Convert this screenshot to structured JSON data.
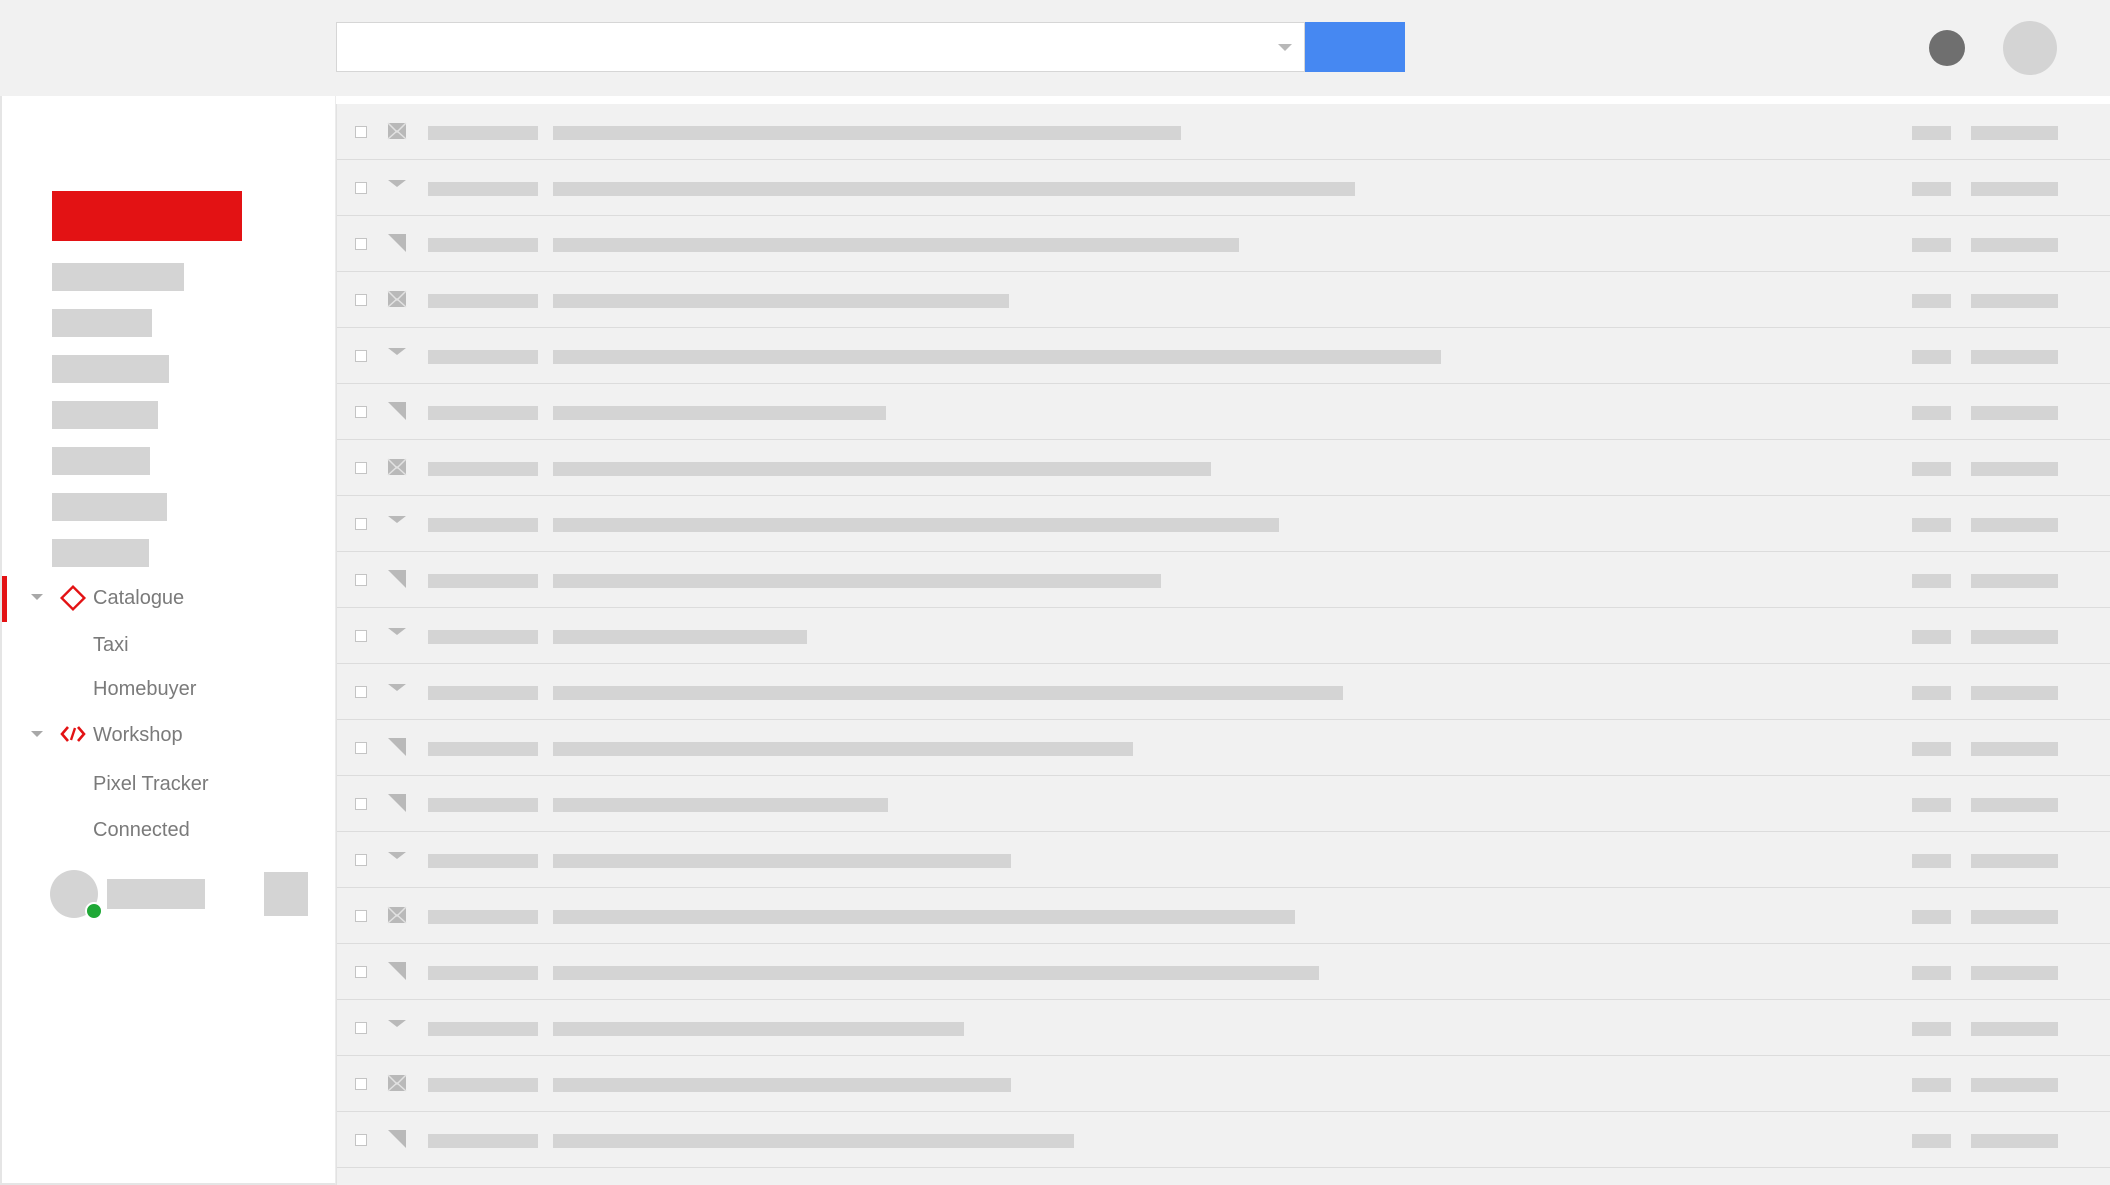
{
  "search": {
    "value": "",
    "placeholder": ""
  },
  "colors": {
    "accent": "#e31214",
    "primary_button": "#4688f2",
    "presence": "#1fa836",
    "placeholder": "#d4d4d4"
  },
  "header": {
    "icons": [
      "status-dot-icon",
      "profile-avatar-icon"
    ]
  },
  "sidebar": {
    "compose_icon": "compose-button",
    "folders": [
      {
        "expanded": true,
        "active": true,
        "icon": "diamond-icon",
        "label": "Catalogue",
        "children": [
          "Taxi",
          "Homebuyer"
        ]
      },
      {
        "expanded": true,
        "active": false,
        "icon": "code-icon",
        "label": "Workshop",
        "children": [
          "Pixel Tracker",
          "Connected"
        ]
      }
    ],
    "user": {
      "online": true
    }
  },
  "messages": {
    "row_count": 19,
    "row_icon_types": [
      "envelope-icon",
      "triangle-down-icon",
      "flag-icon",
      "envelope-icon",
      "triangle-down-icon",
      "flag-icon",
      "envelope-icon",
      "triangle-down-icon",
      "flag-icon",
      "triangle-down-icon",
      "triangle-down-icon",
      "flag-icon",
      "flag-icon",
      "triangle-down-icon",
      "envelope-icon",
      "flag-icon",
      "triangle-down-icon",
      "envelope-icon",
      "flag-icon"
    ]
  }
}
